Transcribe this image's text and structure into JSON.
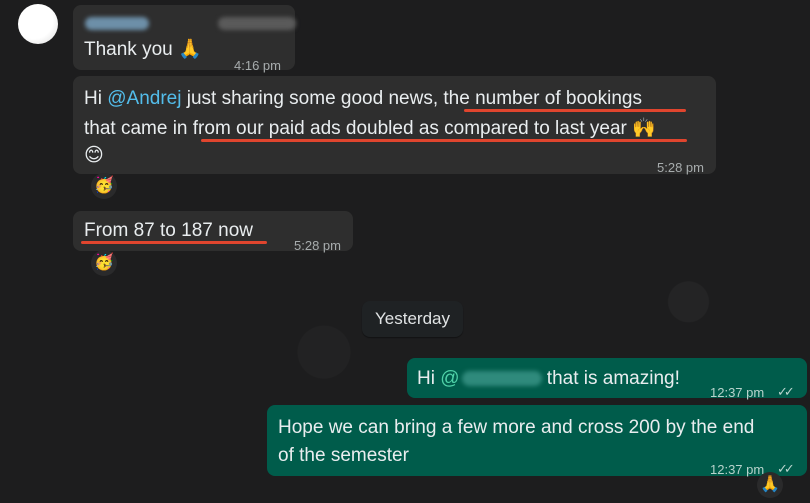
{
  "chat": {
    "date_divider": "Yesterday",
    "messages": [
      {
        "id": "m1",
        "text": "Thank you 🙏",
        "time": "4:16 pm"
      },
      {
        "id": "m2",
        "greeting": "Hi ",
        "mention": "@Andrej",
        "part1": " just sharing some good news, ",
        "hl1": "the number of bookings",
        "line2_pre": "that came in ",
        "hl2": "from our paid ads doubled as compared to last year",
        "line2_emoji": " 🙌",
        "line3_emoji": "😊",
        "time": "5:28 pm",
        "reaction": "🥳"
      },
      {
        "id": "m3",
        "text": "From 87 to 187 now",
        "time": "5:28 pm",
        "reaction": "🥳"
      },
      {
        "id": "m4",
        "greeting": "Hi ",
        "mention": "@",
        "rest": " that is amazing!",
        "time": "12:37 pm",
        "ticks": "✓✓"
      },
      {
        "id": "m5",
        "line1": "Hope we can bring a few more and cross 200 by the end",
        "line2": "of the semester",
        "time": "12:37 pm",
        "ticks": "✓✓",
        "reaction": "🙏"
      }
    ]
  },
  "colors": {
    "incoming": "#2e2e2e",
    "outgoing": "#005c4b",
    "underline": "#e0452e",
    "mention": "#53bdeb"
  }
}
